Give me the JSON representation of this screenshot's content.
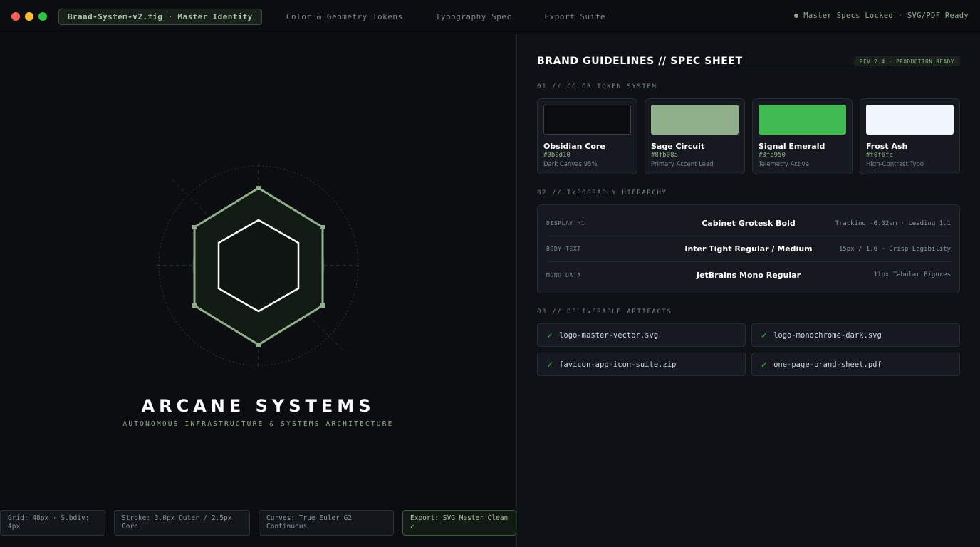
{
  "window": {
    "file_tab": "Brand-System-v2.fig · Master Identity",
    "tabs": [
      "Color & Geometry Tokens",
      "Typography Spec",
      "Export Suite"
    ],
    "status": "Master Specs Locked · SVG/PDF Ready"
  },
  "brand": {
    "name": "ARCANE SYSTEMS",
    "tagline": "AUTONOMOUS INFRASTRUCTURE & SYSTEMS ARCHITECTURE"
  },
  "spec_chips": [
    {
      "text": "Grid: 48px · Subdiv: 4px"
    },
    {
      "text": "Stroke: 3.0px Outer / 2.5px Core"
    },
    {
      "text": "Curves: True Euler G2 Continuous"
    },
    {
      "text": "Export: SVG Master Clean ✓"
    }
  ],
  "sheet": {
    "title": "BRAND GUIDELINES // SPEC SHEET",
    "rev_badge": "REV 2.4 · PRODUCTION READY",
    "sections": {
      "color": "01 // COLOR TOKEN SYSTEM",
      "typography": "02 // TYPOGRAPHY HIERARCHY",
      "artifacts": "03 // DELIVERABLE ARTIFACTS"
    }
  },
  "colors": [
    {
      "name": "Obsidian Core",
      "hex": "#0b0d10",
      "desc": "Dark Canvas 95%"
    },
    {
      "name": "Sage Circuit",
      "hex": "#8fb08a",
      "desc": "Primary Accent Lead"
    },
    {
      "name": "Signal Emerald",
      "hex": "#3fb950",
      "desc": "Telemetry Active"
    },
    {
      "name": "Frost Ash",
      "hex": "#f0f6fc",
      "desc": "High-Contrast Typo"
    }
  ],
  "typography": [
    {
      "role": "DISPLAY H1",
      "font": "Cabinet Grotesk Bold",
      "meta": "Tracking -0.02em · Leading 1.1"
    },
    {
      "role": "BODY TEXT",
      "font": "Inter Tight Regular / Medium",
      "meta": "15px / 1.6 · Crisp Legibility"
    },
    {
      "role": "MONO DATA",
      "font": "JetBrains Mono Regular",
      "meta": "11px Tabular Figures"
    }
  ],
  "artifacts": [
    {
      "file": "logo-master-vector.svg",
      "icon": "check-icon"
    },
    {
      "file": "logo-monochrome-dark.svg",
      "icon": "check-icon"
    },
    {
      "file": "favicon-app-icon-suite.zip",
      "icon": "check-icon"
    },
    {
      "file": "one-page-brand-sheet.pdf",
      "icon": "check-icon"
    }
  ],
  "accent_colors": {
    "sage": "#8fb08a",
    "emerald": "#3fb950",
    "canvas": "#0b0d10",
    "frost": "#f0f6fc"
  }
}
